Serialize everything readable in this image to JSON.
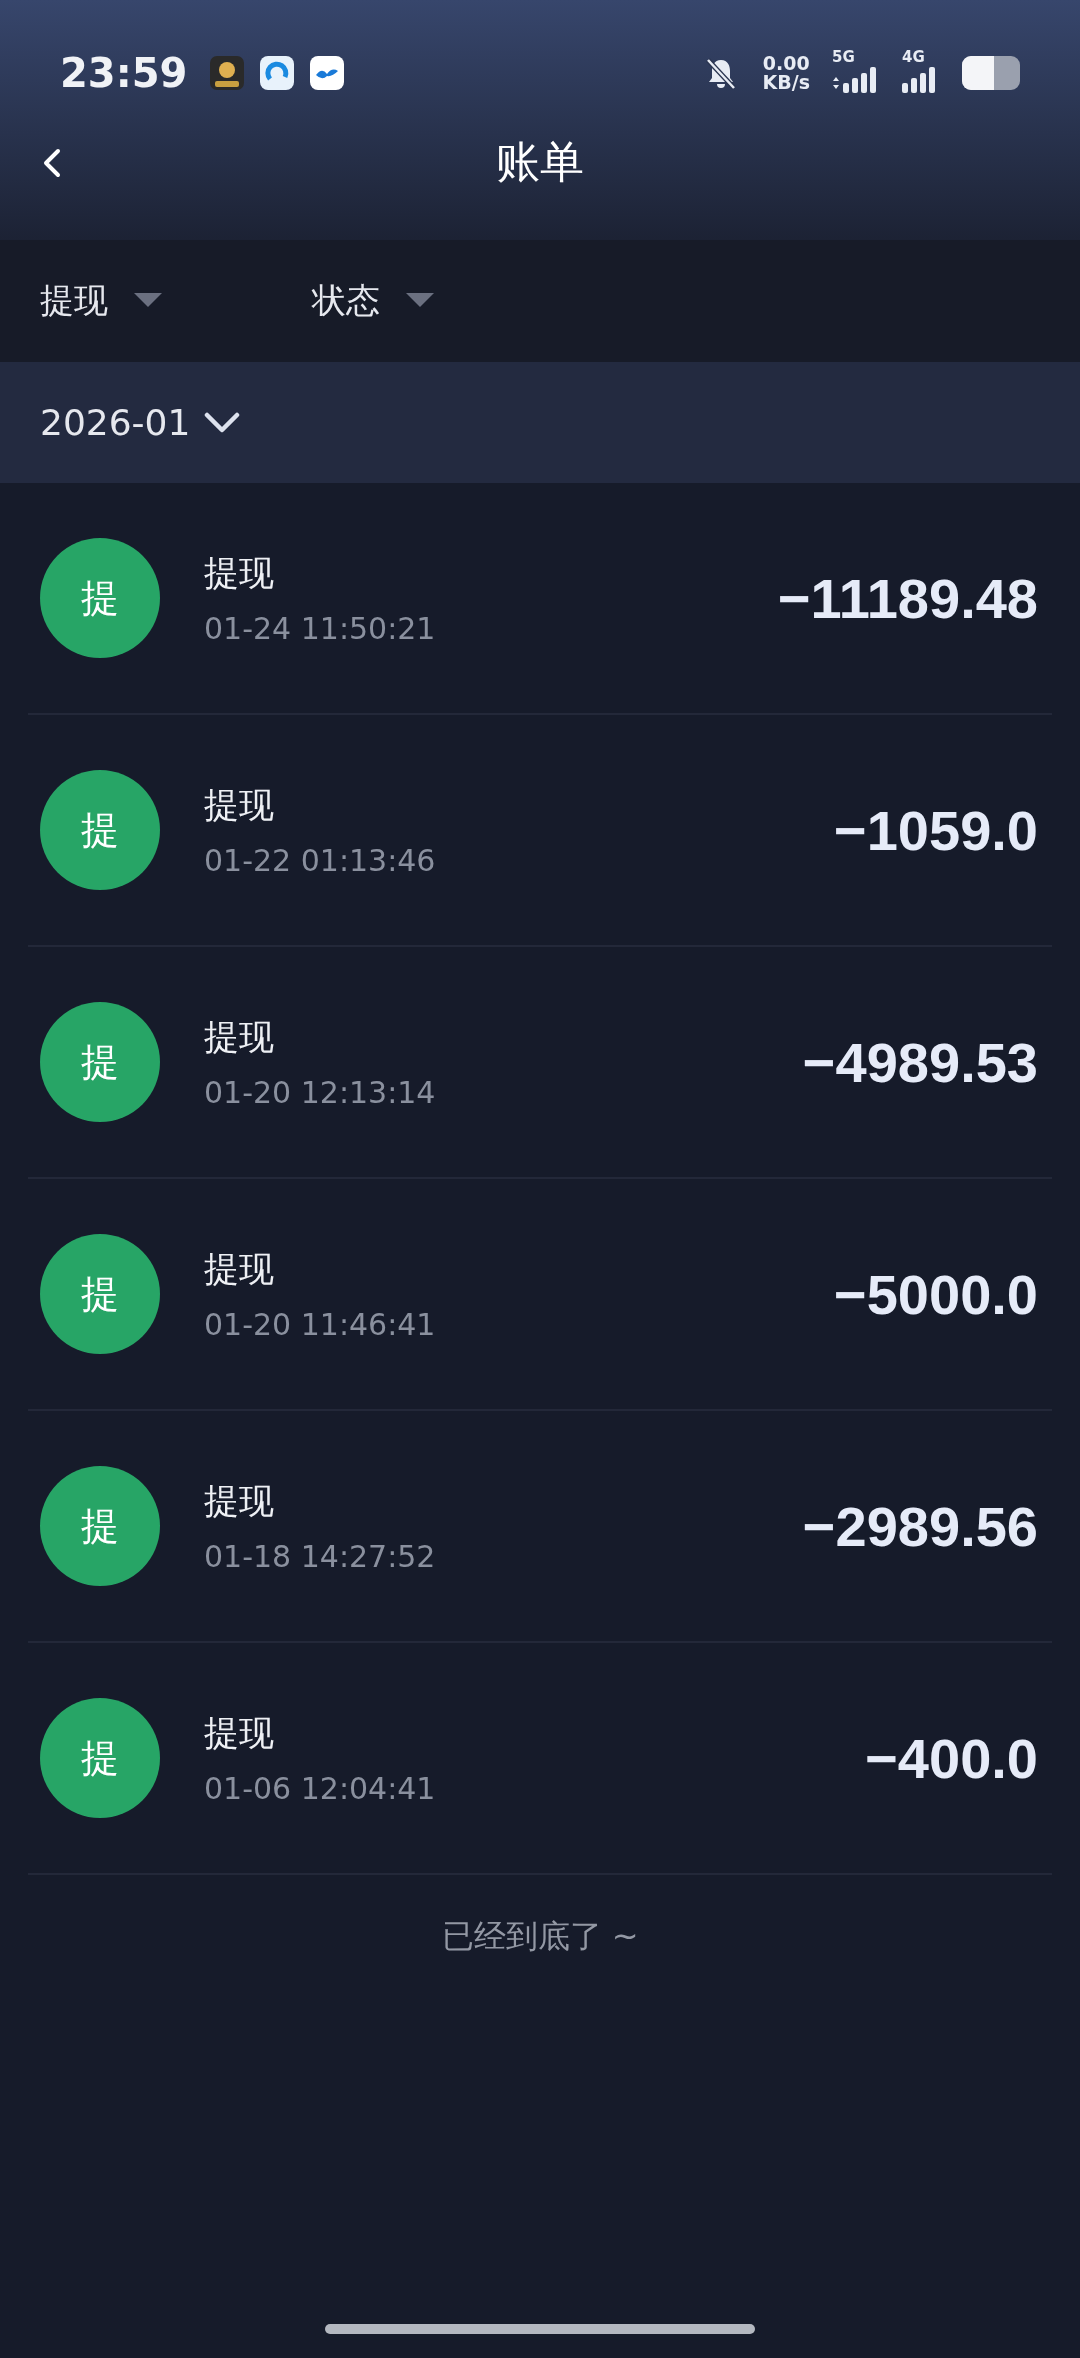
{
  "status_bar": {
    "time": "23:59",
    "net_speed": "0.00",
    "net_unit": "KB/s",
    "sim1": "5G",
    "sim2": "4G"
  },
  "header": {
    "title": "账单"
  },
  "filters": [
    {
      "label": "提现"
    },
    {
      "label": "状态"
    }
  ],
  "month": {
    "label": "2026-01"
  },
  "records": [
    {
      "badge": "提",
      "title": "提现",
      "time": "01-24 11:50:21",
      "amount": "−11189.48"
    },
    {
      "badge": "提",
      "title": "提现",
      "time": "01-22 01:13:46",
      "amount": "−1059.0"
    },
    {
      "badge": "提",
      "title": "提现",
      "time": "01-20 12:13:14",
      "amount": "−4989.53"
    },
    {
      "badge": "提",
      "title": "提现",
      "time": "01-20 11:46:41",
      "amount": "−5000.0"
    },
    {
      "badge": "提",
      "title": "提现",
      "time": "01-18 14:27:52",
      "amount": "−2989.56"
    },
    {
      "badge": "提",
      "title": "提现",
      "time": "01-06 12:04:41",
      "amount": "−400.0"
    }
  ],
  "footer": "已经到底了 ~"
}
